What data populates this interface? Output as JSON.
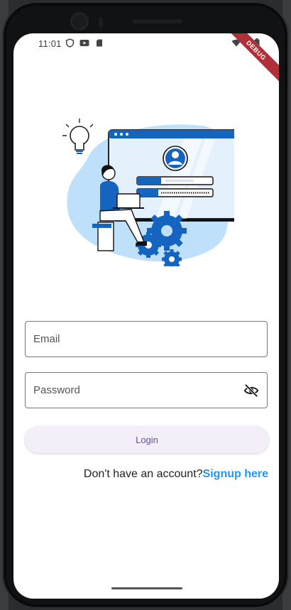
{
  "status_bar": {
    "time": "11:01",
    "icons": [
      "shield-icon",
      "youtube-icon",
      "sd-card-icon",
      "wifi-icon",
      "signal-icon",
      "battery-icon"
    ]
  },
  "debug_banner": "DEBUG",
  "form": {
    "email_placeholder": "Email",
    "password_placeholder": "Password",
    "login_label": "Login"
  },
  "signup": {
    "prompt": "Don't have an account?",
    "link": "Signup here"
  },
  "colors": {
    "accent": "#2196f3",
    "button_bg": "#f3eef8",
    "button_text": "#6750a4",
    "illustration_blue": "#1565c0",
    "blob": "#bfe0fb"
  }
}
